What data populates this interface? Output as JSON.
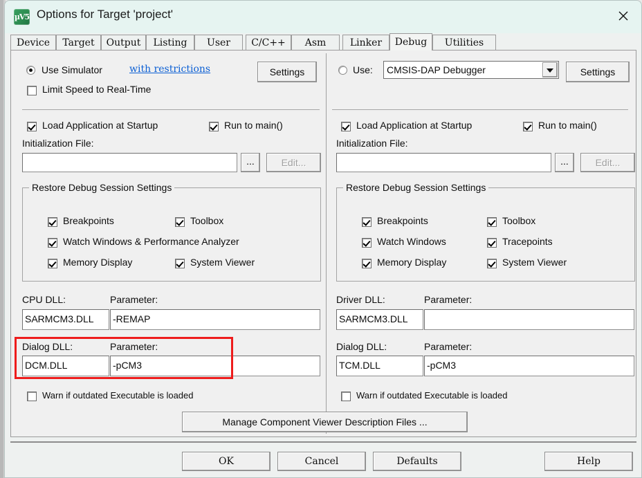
{
  "window": {
    "title": "Options for Target 'project'",
    "icon": "keil-uvision-icon",
    "close_icon": "close-icon"
  },
  "tabs": [
    {
      "label": "Device",
      "selected": false
    },
    {
      "label": "Target",
      "selected": false
    },
    {
      "label": "Output",
      "selected": false
    },
    {
      "label": "Listing",
      "selected": false
    },
    {
      "label": "User",
      "selected": false
    },
    {
      "label": "C/C++",
      "selected": false
    },
    {
      "label": "Asm",
      "selected": false
    },
    {
      "label": "Linker",
      "selected": false
    },
    {
      "label": "Debug",
      "selected": true
    },
    {
      "label": "Utilities",
      "selected": false
    }
  ],
  "left_panel": {
    "use_simulator_label": "Use Simulator",
    "use_simulator_selected": true,
    "restrictions_link": "with restrictions",
    "settings_button": "Settings",
    "limit_speed_label": "Limit Speed to Real-Time",
    "limit_speed_checked": false,
    "load_app_label": "Load Application at Startup",
    "load_app_checked": true,
    "run_to_main_label": "Run to main()",
    "run_to_main_checked": true,
    "init_file_label": "Initialization File:",
    "init_file_value": "",
    "browse_button": "...",
    "edit_button": "Edit...",
    "restore_group_title": "Restore Debug Session Settings",
    "restore_items": [
      {
        "label": "Breakpoints",
        "checked": true
      },
      {
        "label": "Toolbox",
        "checked": true
      },
      {
        "label": "Watch Windows & Performance Analyzer",
        "checked": true
      },
      {
        "label": "Memory Display",
        "checked": true
      },
      {
        "label": "System Viewer",
        "checked": true
      }
    ],
    "cpu_dll_label": "CPU DLL:",
    "cpu_dll_value": "SARMCM3.DLL",
    "cpu_param_label": "Parameter:",
    "cpu_param_value": "-REMAP",
    "dialog_dll_label": "Dialog DLL:",
    "dialog_dll_value": "DCM.DLL",
    "dialog_param_label": "Parameter:",
    "dialog_param_value": "-pCM3",
    "warn_label": "Warn if outdated Executable is loaded",
    "warn_checked": false
  },
  "right_panel": {
    "use_label": "Use:",
    "use_selected": false,
    "debugger_value": "CMSIS-DAP Debugger",
    "settings_button": "Settings",
    "load_app_label": "Load Application at Startup",
    "load_app_checked": true,
    "run_to_main_label": "Run to main()",
    "run_to_main_checked": true,
    "init_file_label": "Initialization File:",
    "init_file_value": "",
    "browse_button": "...",
    "edit_button": "Edit...",
    "restore_group_title": "Restore Debug Session Settings",
    "restore_items": [
      {
        "label": "Breakpoints",
        "checked": true
      },
      {
        "label": "Toolbox",
        "checked": true
      },
      {
        "label": "Watch Windows",
        "checked": true
      },
      {
        "label": "Tracepoints",
        "checked": true
      },
      {
        "label": "Memory Display",
        "checked": true
      },
      {
        "label": "System Viewer",
        "checked": true
      }
    ],
    "driver_dll_label": "Driver DLL:",
    "driver_dll_value": "SARMCM3.DLL",
    "driver_param_label": "Parameter:",
    "driver_param_value": "",
    "dialog_dll_label": "Dialog DLL:",
    "dialog_dll_value": "TCM.DLL",
    "dialog_param_label": "Parameter:",
    "dialog_param_value": "-pCM3",
    "warn_label": "Warn if outdated Executable is loaded",
    "warn_checked": false
  },
  "manage_button": "Manage Component Viewer Description Files ...",
  "footer": {
    "ok": "OK",
    "cancel": "Cancel",
    "defaults": "Defaults",
    "help": "Help"
  },
  "annotation": {
    "highlight_color": "#ee1c1c",
    "highlight_target": "dialog-dll-row-left"
  }
}
